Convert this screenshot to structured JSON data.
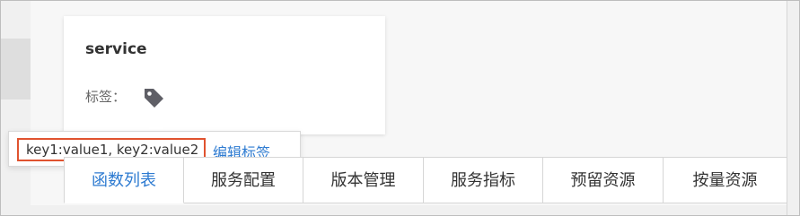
{
  "card": {
    "title": "service",
    "tag_label": "标签：",
    "tag_value": "key1:value1, key2:value2",
    "edit_tag_link": "编辑标签"
  },
  "tabs": [
    {
      "label": "函数列表",
      "active": true
    },
    {
      "label": "服务配置",
      "active": false
    },
    {
      "label": "版本管理",
      "active": false
    },
    {
      "label": "服务指标",
      "active": false
    },
    {
      "label": "预留资源",
      "active": false
    },
    {
      "label": "按量资源",
      "active": false
    }
  ],
  "colors": {
    "accent": "#2e7bd1",
    "highlight_border": "#e0532f",
    "tag_icon": "#5f5f66"
  },
  "icons": {
    "tag": "tag-icon"
  }
}
